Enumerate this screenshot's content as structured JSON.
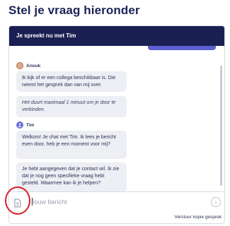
{
  "page": {
    "title": "Stel je vraag hieronder"
  },
  "chat": {
    "header": "Je spreekt nu met Tim",
    "messages": [
      {
        "author": "Anouk",
        "text": "Ik kijk of er een collega beschikbaar is. Die neemt het gesprek dan van mij over."
      },
      {
        "author": "Anouk",
        "text": "Het duurt maximaal 1 minuut om je door te verbinden.",
        "style": "italic"
      },
      {
        "author": "Tim",
        "text": "Welkom! Je chat met Tim. Ik lees je bericht even door, heb je een moment voor mij?"
      },
      {
        "author": "Tim",
        "text": "Je hebt aangegeven dat je contact wil. Ik zie dat je nog geen specifieke vraag hebt gesteld. Waarmee kan ik je helpen?"
      }
    ],
    "authors": {
      "anouk": "Anouk",
      "tim": "Tim"
    }
  },
  "composer": {
    "placeholder": "Jouw bericht",
    "attach_icon": "document-attach-icon",
    "send_icon": "send-arrow-icon",
    "send_symbol": "›"
  },
  "footer": {
    "download_label": "Verstuur kopie gesprek"
  },
  "colors": {
    "header_bg": "#1b2053",
    "accent": "#5e5fd0",
    "bubble_bg": "#eeeff4",
    "highlight": "#d81f26"
  }
}
